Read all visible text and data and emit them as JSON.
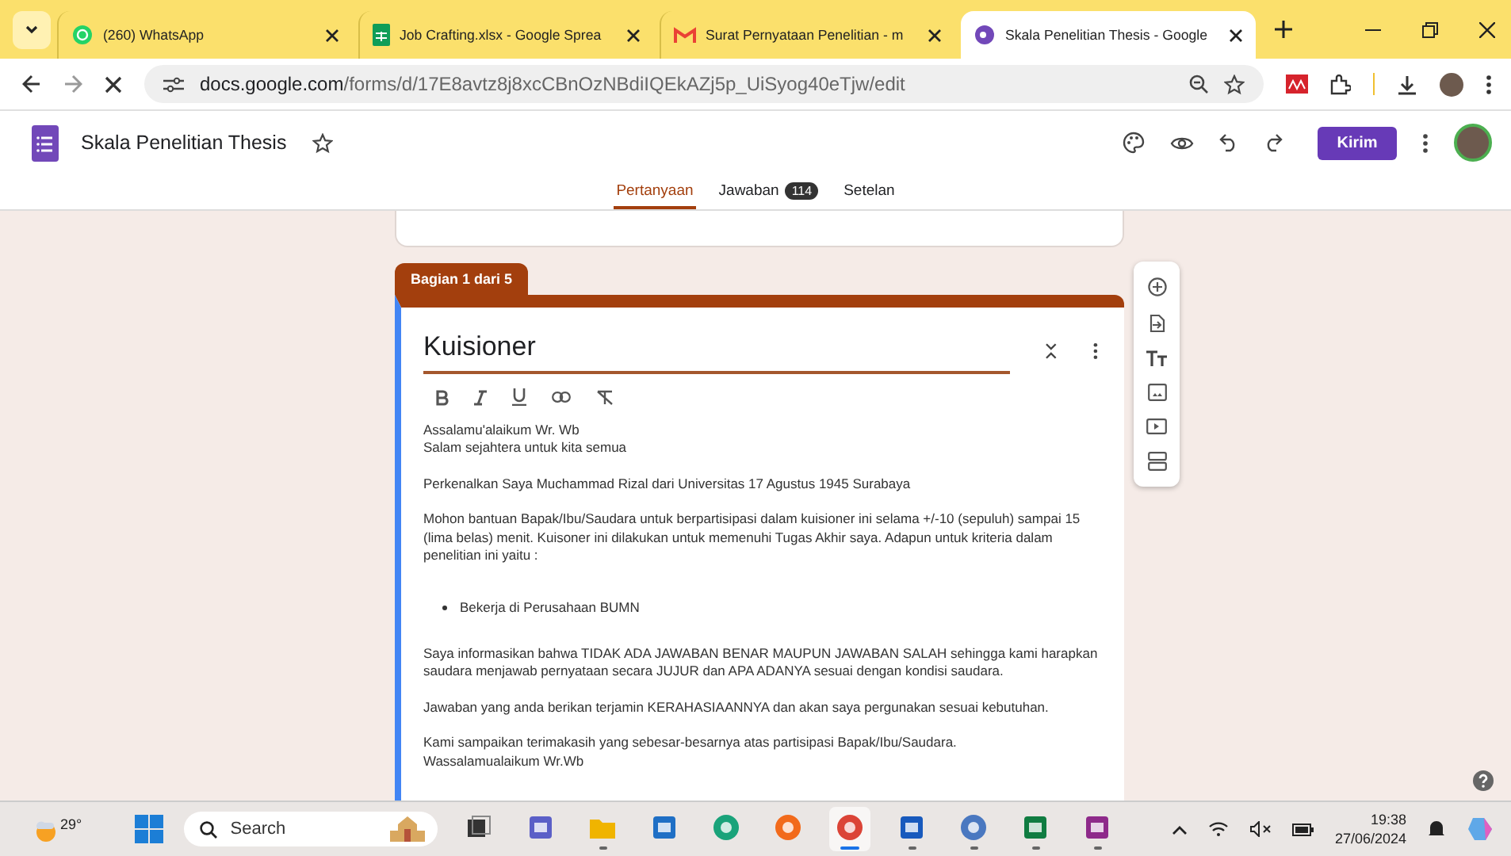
{
  "browser": {
    "tabs": [
      {
        "kind": "whatsapp",
        "title": "(260) WhatsApp",
        "selected": false
      },
      {
        "kind": "sheets",
        "title": "Job Crafting.xlsx - Google Sprea",
        "selected": false
      },
      {
        "kind": "gmail",
        "title": "Surat Pernyataan Penelitian - m",
        "selected": false
      },
      {
        "kind": "forms",
        "title": "Skala Penelitian Thesis - Google",
        "selected": true
      }
    ],
    "url_host": "docs.google.com",
    "url_path": "/forms/d/17E8avtz8j8xcCBnOzNBdiIQEkAZj5p_UiSyog40eTjw/edit"
  },
  "form": {
    "title": "Skala Penelitian Thesis",
    "send_button": "Kirim",
    "tabs": [
      {
        "label": "Pertanyaan",
        "selected": true
      },
      {
        "label": "Jawaban",
        "selected": false,
        "count": "114"
      },
      {
        "label": "Setelan",
        "selected": false
      }
    ],
    "section": {
      "badge": "Bagian 1 dari 5",
      "title": "Kuisioner",
      "blocks": [
        {
          "kind": "para",
          "lines": [
            "Assalamu'alaikum Wr. Wb",
            "Salam sejahtera untuk kita semua"
          ]
        },
        {
          "kind": "para",
          "lines": [
            "Perkenalkan Saya Muchammad Rizal dari Universitas 17 Agustus 1945 Surabaya"
          ]
        },
        {
          "kind": "para",
          "lines": [
            "Mohon bantuan Bapak/Ibu/Saudara untuk berpartisipasi dalam kuisioner ini selama +/-10 (sepuluh) sampai 15 (lima belas) menit. Kuisoner ini dilakukan untuk memenuhi Tugas Akhir saya. Adapun untuk kriteria dalam penelitian ini yaitu :"
          ]
        },
        {
          "kind": "bullet",
          "lines": [
            "Bekerja di Perusahaan BUMN"
          ]
        },
        {
          "kind": "para",
          "lines": [
            "Saya informasikan bahwa TIDAK ADA JAWABAN BENAR MAUPUN JAWABAN SALAH sehingga kami harapkan saudara menjawab pernyataan secara JUJUR dan APA ADANYA sesuai dengan kondisi saudara."
          ]
        },
        {
          "kind": "para",
          "lines": [
            "Jawaban yang anda berikan terjamin KERAHASIAANNYA dan akan saya pergunakan sesuai kebutuhan."
          ]
        },
        {
          "kind": "para",
          "lines": [
            "Kami sampaikan terimakasih yang sebesar-besarnya atas partisipasi Bapak/Ibu/Saudara.",
            "Wassalamualaikum Wr.Wb"
          ]
        }
      ]
    }
  },
  "taskbar": {
    "temperature": "29°",
    "search_placeholder": "Search",
    "time": "19:38",
    "date": "27/06/2024",
    "apps": [
      {
        "kind": "taskview",
        "selected": false,
        "open": false
      },
      {
        "kind": "teams",
        "selected": false,
        "open": false
      },
      {
        "kind": "files",
        "selected": false,
        "open": true
      },
      {
        "kind": "store",
        "selected": false,
        "open": false
      },
      {
        "kind": "edge",
        "selected": false,
        "open": false
      },
      {
        "kind": "firefox",
        "selected": false,
        "open": false
      },
      {
        "kind": "chrome",
        "selected": true,
        "open": true
      },
      {
        "kind": "word",
        "selected": false,
        "open": true
      },
      {
        "kind": "calculator",
        "selected": false,
        "open": true
      },
      {
        "kind": "excel",
        "selected": false,
        "open": true
      },
      {
        "kind": "pdf",
        "selected": false,
        "open": true
      }
    ]
  }
}
